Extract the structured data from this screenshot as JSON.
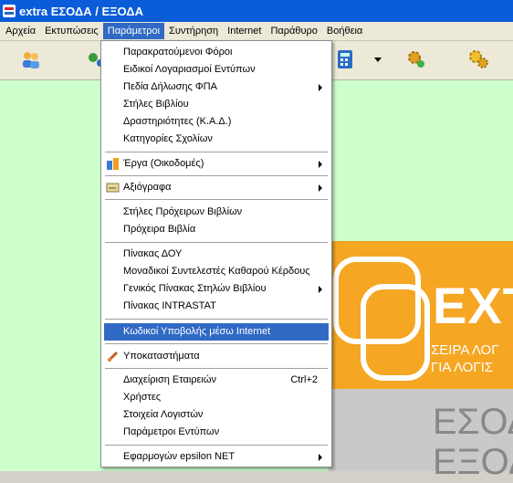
{
  "window": {
    "title": "extra ΕΣΟΔΑ / ΕΞΟΔΑ"
  },
  "menubar": [
    {
      "label": "Αρχεία"
    },
    {
      "label": "Εκτυπώσεις"
    },
    {
      "label": "Παράμετροι"
    },
    {
      "label": "Συντήρηση"
    },
    {
      "label": "Internet"
    },
    {
      "label": "Παράθυρο"
    },
    {
      "label": "Βοήθεια"
    }
  ],
  "menu": {
    "items": [
      {
        "label": "Παρακρατούμενοι Φόροι"
      },
      {
        "label": "Ειδικοί Λογαριασμοί Εντύπων"
      },
      {
        "label": "Πεδία Δήλωσης ΦΠΑ"
      },
      {
        "label": "Στήλες Βιβλίου"
      },
      {
        "label": "Δραστηριότητες (Κ.Α.Δ.)"
      },
      {
        "label": "Κατηγορίες Σχολίων"
      },
      {
        "label": "Έργα (Οικοδομές)"
      },
      {
        "label": "Αξιόγραφα"
      },
      {
        "label": "Στήλες Πρόχειρων Βιβλίων"
      },
      {
        "label": "Πρόχειρα Βιβλία"
      },
      {
        "label": "Πίνακας ΔΟΥ"
      },
      {
        "label": "Μοναδικοί Συντελεστές Καθαρού Κέρδους"
      },
      {
        "label": "Γενικός Πίνακας Στηλών Βιβλίου"
      },
      {
        "label": "Πίνακας INTRASTAT"
      },
      {
        "label": "Κωδικοί Υποβολής μέσω Internet"
      },
      {
        "label": "Υποκαταστήματα"
      },
      {
        "label": "Διαχείριση Εταιρειών",
        "shortcut": "Ctrl+2"
      },
      {
        "label": "Χρήστες"
      },
      {
        "label": "Στοιχεία Λογιστών"
      },
      {
        "label": "Παράμετροι Εντύπων"
      },
      {
        "label": "Εφαρμογών epsilon NET"
      }
    ]
  },
  "splash": {
    "brand": "EXT",
    "line1": "ΣΕΙΡΑ ΛΟΓ",
    "line2": "ΓΙΑ ΛΟΓΙΣ",
    "line3": "ΕΣΟΔ",
    "line4": "ΕΞΟΔ"
  },
  "colors": {
    "titlebar": "#0a5cd8",
    "highlight": "#316ac5",
    "client": "#ccffcc",
    "splash": "#f5a623"
  }
}
